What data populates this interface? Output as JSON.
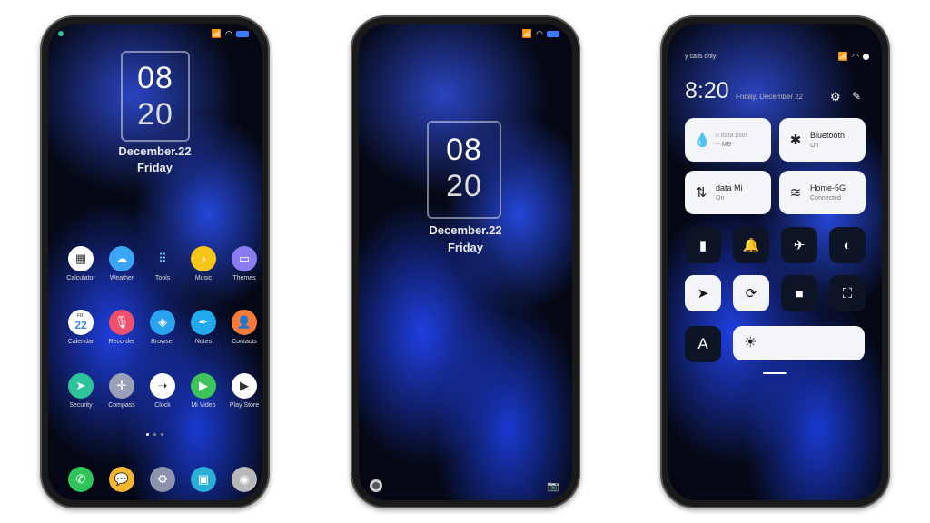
{
  "home": {
    "time_hour": "08",
    "time_minute": "20",
    "date": "December.22",
    "weekday": "Friday",
    "apps": [
      {
        "label": "Calculator",
        "icon": "calculator-icon",
        "color": "#ffffff"
      },
      {
        "label": "Weather",
        "icon": "weather-icon",
        "color": "#3aa6f5"
      },
      {
        "label": "Tools",
        "icon": "tools-icon",
        "color": "transparent"
      },
      {
        "label": "Music",
        "icon": "music-icon",
        "color": "#f5c518"
      },
      {
        "label": "Themes",
        "icon": "themes-icon",
        "color": "#8a7cf0"
      },
      {
        "label": "Calendar",
        "icon": "calendar-icon",
        "color": "#ffffff"
      },
      {
        "label": "Recorder",
        "icon": "recorder-icon",
        "color": "#f0506e"
      },
      {
        "label": "Browser",
        "icon": "browser-icon",
        "color": "#2aa4ee"
      },
      {
        "label": "Notes",
        "icon": "notes-icon",
        "color": "#22aaee"
      },
      {
        "label": "Contacts",
        "icon": "contacts-icon",
        "color": "#f57a3a"
      },
      {
        "label": "Security",
        "icon": "security-icon",
        "color": "#2ec49a"
      },
      {
        "label": "Compass",
        "icon": "compass-icon",
        "color": "#9aa0b8"
      },
      {
        "label": "Clock",
        "icon": "clock-icon",
        "color": "#ffffff"
      },
      {
        "label": "Mi Video",
        "icon": "video-icon",
        "color": "#3ec45a"
      },
      {
        "label": "Play Store",
        "icon": "play-store-icon",
        "color": "#ffffff"
      }
    ],
    "calendar_day": "22",
    "calendar_weekday": "FRI",
    "dock": [
      {
        "icon": "phone-icon",
        "color": "#2ec45a"
      },
      {
        "icon": "messages-icon",
        "color": "#f5b531"
      },
      {
        "icon": "settings-icon",
        "color": "#8c93ad"
      },
      {
        "icon": "screenshot-icon",
        "color": "#2ab0d8"
      },
      {
        "icon": "camera-icon",
        "color": "#b8b8b8"
      }
    ]
  },
  "lock": {
    "time_hour": "08",
    "time_minute": "20",
    "date": "December.22",
    "weekday": "Friday"
  },
  "control": {
    "status_text": "y calls only",
    "time": "8:20",
    "date": "Friday, December 22",
    "tiles": [
      {
        "title": "n data plan",
        "sub": "-- MB",
        "icon": "water-drop-icon"
      },
      {
        "title": "Bluetooth",
        "sub": "On",
        "icon": "bluetooth-icon"
      },
      {
        "title": "data     Mi",
        "sub": "On",
        "icon": "mobile-data-icon"
      },
      {
        "title": "Home-5G",
        "sub": "Connected",
        "icon": "wifi-icon"
      }
    ],
    "toggles": [
      {
        "icon": "flashlight-icon",
        "on": false
      },
      {
        "icon": "bell-icon",
        "on": false
      },
      {
        "icon": "airplane-icon",
        "on": false
      },
      {
        "icon": "contrast-icon",
        "on": false
      },
      {
        "icon": "location-icon",
        "on": true
      },
      {
        "icon": "rotation-lock-icon",
        "on": true
      },
      {
        "icon": "video-camera-icon",
        "on": false
      },
      {
        "icon": "scan-icon",
        "on": false
      }
    ],
    "font_label": "A",
    "brightness": 0.05
  }
}
